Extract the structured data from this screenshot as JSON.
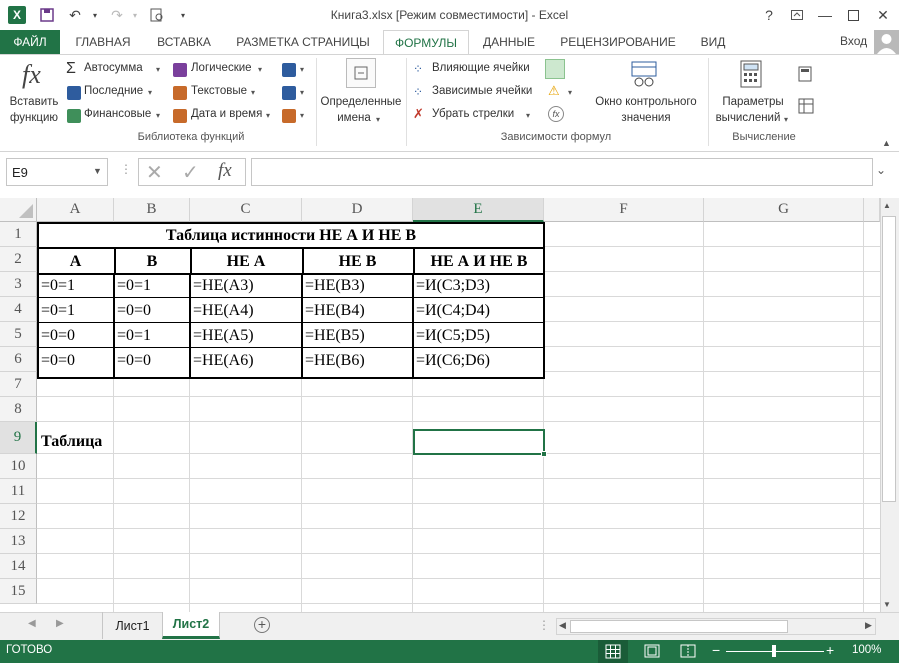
{
  "window": {
    "title": "Книга3.xlsx  [Режим совместимости] - Excel",
    "help": "?",
    "sign_in": "Вход"
  },
  "tabs": [
    "ФАЙЛ",
    "ГЛАВНАЯ",
    "ВСТАВКА",
    "РАЗМЕТКА СТРАНИЦЫ",
    "ФОРМУЛЫ",
    "ДАННЫЕ",
    "РЕЦЕНЗИРОВАНИЕ",
    "ВИД"
  ],
  "active_tab": "ФОРМУЛЫ",
  "ribbon": {
    "insert_function": {
      "line1": "Вставить",
      "line2": "функцию"
    },
    "library": {
      "autosum": "Автосумма",
      "recent": "Последние",
      "financial": "Финансовые",
      "logical": "Логические",
      "text": "Текстовые",
      "datetime": "Дата и время",
      "label": "Библиотека функций"
    },
    "defined_names": {
      "line1": "Определенные",
      "line2": "имена"
    },
    "auditing": {
      "precedents": "Влияющие ячейки",
      "dependents": "Зависимые ячейки",
      "remove_arrows": "Убрать стрелки",
      "label": "Зависимости формул"
    },
    "watch": {
      "line1": "Окно контрольного",
      "line2": "значения"
    },
    "calc": {
      "line1": "Параметры",
      "line2": "вычислений",
      "label": "Вычисление"
    }
  },
  "formula_bar": {
    "name_box": "E9",
    "fx": "fx",
    "value": ""
  },
  "columns": [
    "A",
    "B",
    "C",
    "D",
    "E",
    "F",
    "G"
  ],
  "selected_column": "E",
  "rows": [
    "1",
    "2",
    "3",
    "4",
    "5",
    "6",
    "7",
    "8",
    "9",
    "10",
    "11",
    "12",
    "13",
    "14",
    "15"
  ],
  "selected_row": "9",
  "table": {
    "title": "Таблица истинности НЕ А И НЕ В",
    "headers": [
      "А",
      "В",
      "НЕ А",
      "НЕ В",
      "НЕ А И НЕ В"
    ],
    "rows": [
      [
        "=0=1",
        "=0=1",
        "=НЕ(A3)",
        "=НЕ(B3)",
        "=И(C3;D3)"
      ],
      [
        "=0=1",
        "=0=0",
        "=НЕ(A4)",
        "=НЕ(B4)",
        "=И(C4;D4)"
      ],
      [
        "=0=0",
        "=0=1",
        "=НЕ(A5)",
        "=НЕ(B5)",
        "=И(C5;D5)"
      ],
      [
        "=0=0",
        "=0=0",
        "=НЕ(A6)",
        "=НЕ(B6)",
        "=И(C6;D6)"
      ]
    ]
  },
  "a9_text": "Таблица",
  "sheets": [
    "Лист1",
    "Лист2"
  ],
  "active_sheet": "Лист2",
  "status": {
    "ready": "ГОТОВО",
    "zoom": "100%"
  },
  "colors": {
    "accent": "#217346"
  }
}
